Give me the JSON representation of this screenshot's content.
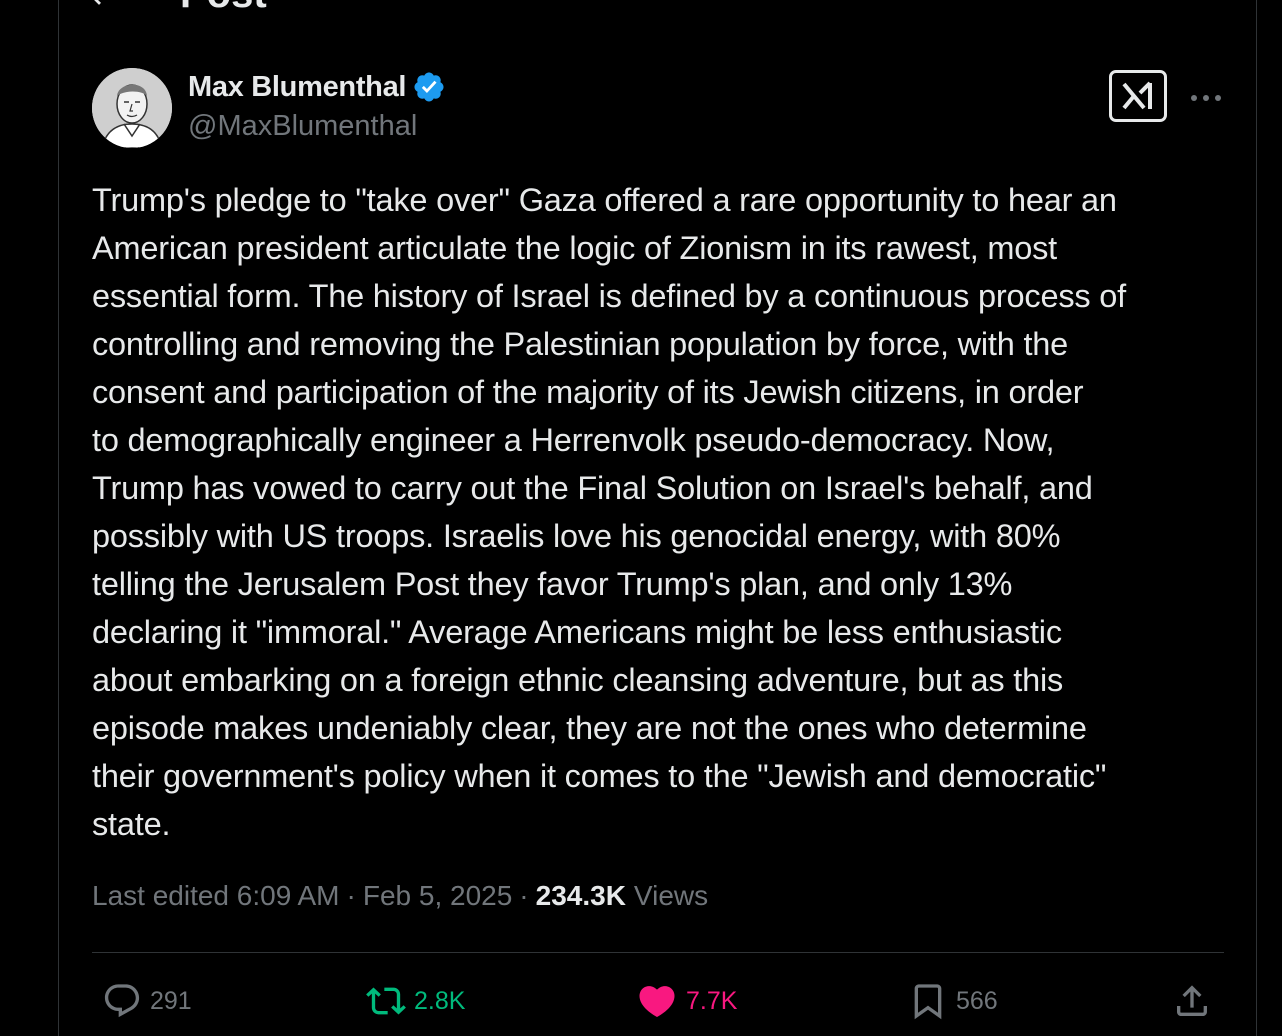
{
  "header": {
    "title": "Post",
    "back_icon": "arrow-left-icon"
  },
  "author": {
    "name": "Max Blumenthal",
    "handle": "@MaxBlumenthal",
    "verified": true,
    "verified_color": "#1d9bf0",
    "avatar": "avatar-illustration"
  },
  "toolbar": {
    "grok_icon": "grok-icon",
    "more_icon": "more-horizontal-icon"
  },
  "post": {
    "lines": [
      "Trump's pledge to \"take over\" Gaza offered a rare opportunity to hear an",
      "American president articulate the logic of Zionism in its rawest, most",
      "essential form. The history of Israel is defined by a continuous process of",
      "controlling and removing the Palestinian population by force, with the",
      "consent and participation of the majority of its Jewish citizens, in order",
      "to demographically engineer a Herrenvolk pseudo-democracy. Now,",
      "Trump has vowed to carry out the Final Solution on Israel's behalf, and",
      "possibly with US troops. Israelis love his genocidal energy, with 80%",
      "telling the Jerusalem Post they favor Trump's plan, and only 13%",
      "declaring it \"immoral.\" Average Americans might be less enthusiastic",
      "about embarking on a foreign ethnic cleansing adventure, but as this",
      "episode makes undeniably clear, they are not the ones who determine",
      "their government's policy when it comes to the \"Jewish and democratic\"",
      "state."
    ]
  },
  "meta": {
    "edited_label": "Last edited 6:09 AM",
    "separator": "·",
    "date": "Feb 5, 2025",
    "views_count": "234.3K",
    "views_label": "Views"
  },
  "actions": {
    "reply_count": "291",
    "repost_count": "2.8K",
    "like_count": "7.7K",
    "bookmark_count": "566",
    "repost_color": "#00ba7c",
    "like_color": "#f91880",
    "muted_color": "#71767b"
  }
}
